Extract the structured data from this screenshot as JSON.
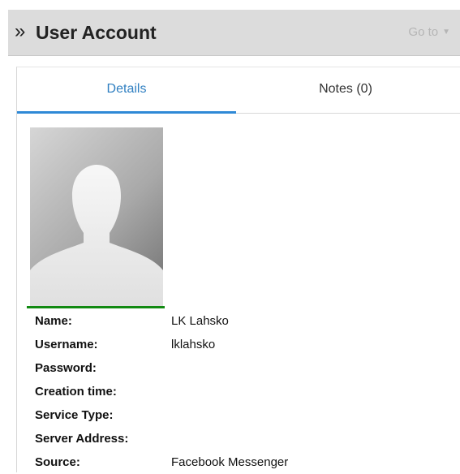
{
  "header": {
    "chevron": "»",
    "title": "User Account",
    "goto": "Go to",
    "goto_caret": "▼"
  },
  "tabs": [
    {
      "label": "Details",
      "active": true
    },
    {
      "label": "Notes (0)",
      "active": false
    }
  ],
  "avatar": {
    "icon": "user-silhouette-icon"
  },
  "details": {
    "rows": [
      {
        "label": "Name:",
        "value": "LK Lahsko"
      },
      {
        "label": "Username:",
        "value": "lklahsko"
      },
      {
        "label": "Password:",
        "value": ""
      },
      {
        "label": "Creation time:",
        "value": ""
      },
      {
        "label": "Service Type:",
        "value": ""
      },
      {
        "label": "Server Address:",
        "value": ""
      },
      {
        "label": "Source:",
        "value": "Facebook Messenger"
      }
    ]
  },
  "colors": {
    "header_bg": "#dcdcdc",
    "tab_active": "#2f7fc1",
    "tab_underline": "#2f89d6",
    "avatar_bar": "#128a12"
  }
}
